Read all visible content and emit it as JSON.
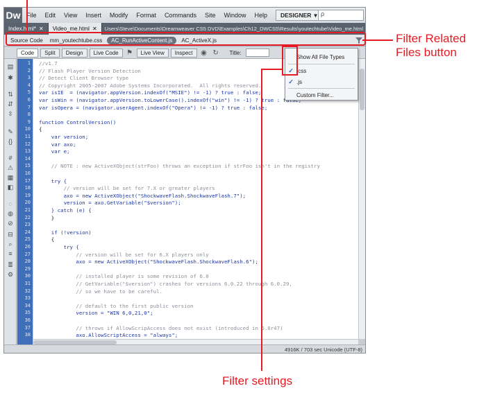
{
  "menubar": {
    "logo": "Dw",
    "items": [
      "File",
      "Edit",
      "View",
      "Insert",
      "Modify",
      "Format",
      "Commands",
      "Site",
      "Window",
      "Help"
    ],
    "workspace": "DESIGNER",
    "search_value": "ρ"
  },
  "tabs": [
    {
      "label": "Index.html*"
    },
    {
      "label": "Video_me.html"
    }
  ],
  "doc_path": "Users\\Steve\\Documents\\Dreamweaver CS5 DVD\\Examples\\Ch12_DWCS5\\Results\\youtechtube\\Video_me.html",
  "related_files": [
    "Source Code",
    "mm_youtechtube.css",
    "AC_RunActiveContent.js",
    "AC_ActiveX.js"
  ],
  "viewbar": {
    "code": "Code",
    "split": "Split",
    "design": "Design",
    "live_code": "Live Code",
    "live_view": "Live View",
    "inspect": "Inspect",
    "title_label": "Title:"
  },
  "filter_menu": {
    "items": [
      {
        "label": "Show All File Types",
        "checked": false
      },
      {
        "label": ".css",
        "checked": true
      },
      {
        "label": ".js",
        "checked": true
      },
      {
        "label": "Custom Filter...",
        "checked": false
      }
    ]
  },
  "code_lines": [
    {
      "n": "1",
      "text": "//v1.7",
      "kind": "comment"
    },
    {
      "n": "2",
      "text": "// Flash Player Version Detection",
      "kind": "comment"
    },
    {
      "n": "3",
      "text": "// Detect Client Browser type",
      "kind": "comment"
    },
    {
      "n": "4",
      "text": "// Copyright 2005-2007 Adobe Systems Incorporated.  All rights reserved.",
      "kind": "comment"
    },
    {
      "n": "5",
      "text": "var isIE  = (navigator.appVersion.indexOf(\"MSIE\") != -1) ? true : false;",
      "kind": "kw"
    },
    {
      "n": "6",
      "text": "var isWin = (navigator.appVersion.toLowerCase().indexOf(\"win\") != -1) ? true : false;",
      "kind": "kw"
    },
    {
      "n": "7",
      "text": "var isOpera = (navigator.userAgent.indexOf(\"Opera\") != -1) ? true : false;",
      "kind": "kw"
    },
    {
      "n": "8",
      "text": "",
      "kind": "plain"
    },
    {
      "n": "9",
      "text": "function ControlVersion()",
      "kind": "kw"
    },
    {
      "n": "10",
      "text": "{",
      "kind": "plain"
    },
    {
      "n": "11",
      "text": "    var version;",
      "kind": "kw"
    },
    {
      "n": "12",
      "text": "    var axo;",
      "kind": "kw"
    },
    {
      "n": "13",
      "text": "    var e;",
      "kind": "kw"
    },
    {
      "n": "14",
      "text": "",
      "kind": "plain"
    },
    {
      "n": "15",
      "text": "    // NOTE : new ActiveXObject(strFoo) throws an exception if strFoo isn't in the registry",
      "kind": "comment"
    },
    {
      "n": "16",
      "text": "",
      "kind": "plain"
    },
    {
      "n": "17",
      "text": "    try {",
      "kind": "kw"
    },
    {
      "n": "18",
      "text": "        // version will be set for 7.X or greater players",
      "kind": "comment"
    },
    {
      "n": "19",
      "text": "        axo = new ActiveXObject(\"ShockwaveFlash.ShockwaveFlash.7\");",
      "kind": "kw"
    },
    {
      "n": "20",
      "text": "        version = axo.GetVariable(\"$version\");",
      "kind": "kw"
    },
    {
      "n": "21",
      "text": "    } catch (e) {",
      "kind": "kw"
    },
    {
      "n": "22",
      "text": "    }",
      "kind": "plain"
    },
    {
      "n": "23",
      "text": "",
      "kind": "plain"
    },
    {
      "n": "24",
      "text": "    if (!version)",
      "kind": "kw"
    },
    {
      "n": "25",
      "text": "    {",
      "kind": "plain"
    },
    {
      "n": "26",
      "text": "        try {",
      "kind": "kw"
    },
    {
      "n": "27",
      "text": "            // version will be set for 6.X players only",
      "kind": "comment"
    },
    {
      "n": "28",
      "text": "            axo = new ActiveXObject(\"ShockwaveFlash.ShockwaveFlash.6\");",
      "kind": "kw"
    },
    {
      "n": "29",
      "text": "",
      "kind": "plain"
    },
    {
      "n": "30",
      "text": "            // installed player is some revision of 6.0",
      "kind": "comment"
    },
    {
      "n": "31",
      "text": "            // GetVariable(\"$version\") crashes for versions 6.0.22 through 6.0.29,",
      "kind": "comment"
    },
    {
      "n": "32",
      "text": "            // so we have to be careful.",
      "kind": "comment"
    },
    {
      "n": "33",
      "text": "",
      "kind": "plain"
    },
    {
      "n": "34",
      "text": "            // default to the first public version",
      "kind": "comment"
    },
    {
      "n": "35",
      "text": "            version = \"WIN 6,0,21,0\";",
      "kind": "kw"
    },
    {
      "n": "36",
      "text": "",
      "kind": "plain"
    },
    {
      "n": "37",
      "text": "            // throws if AllowScripAccess does not exist (introduced in 6.0r47)",
      "kind": "comment"
    },
    {
      "n": "38",
      "text": "            axo.AllowScriptAccess = \"always\";",
      "kind": "kw"
    }
  ],
  "status": "4916K / 703 sec  Unicode (UTF-8)",
  "annotations": {
    "filter_related": "Filter Related",
    "files_button": "Files button",
    "filter_settings": "Filter settings"
  }
}
